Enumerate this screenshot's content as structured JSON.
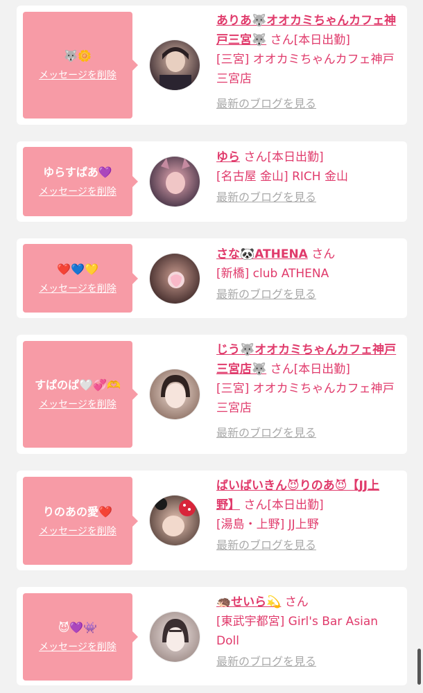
{
  "delete_label": "メッセージを削除",
  "blog_label": "最新のブログを見る",
  "san_label": "さん",
  "entries": [
    {
      "message": "🐺🌼",
      "name": "ありあ🐺オオカミちゃんカフェ神戸三宮🐺",
      "attend": "[本日出勤]",
      "shop": "[三宮] オオカミちゃんカフェ神戸三宮店",
      "avatar_bg": "#4a3a3e"
    },
    {
      "message": "ゆらすぱあ💜",
      "name": "ゆら",
      "attend": "[本日出勤]",
      "shop": "[名古屋 金山] RICH 金山",
      "avatar_bg": "#7a5a7a"
    },
    {
      "message": "❤️💙💛",
      "name": "さな🐼ATHENA",
      "attend": "",
      "shop": "[新橋] club ATHENA",
      "avatar_bg": "#5a3a3a"
    },
    {
      "message": "すぱのぱ🤍💞🫶",
      "name": "じう🐺オオカミちゃんカフェ神戸三宮店🐺",
      "attend": "[本日出勤]",
      "shop": "[三宮] オオカミちゃんカフェ神戸三宮店",
      "avatar_bg": "#a88d7e"
    },
    {
      "message": "りのあの愛❤️",
      "name": "ばいばいきん😈りのあ😈【JJ上野】",
      "attend": "[本日出勤]",
      "shop": "[湯島・上野] JJ上野",
      "avatar_bg": "#6b4a40"
    },
    {
      "message": "😈💜👾",
      "name": "🦔せいら💫",
      "attend": "",
      "shop": "[東武宇都宮] Girl's Bar Asian Doll",
      "avatar_bg": "#b9a9a6"
    }
  ]
}
